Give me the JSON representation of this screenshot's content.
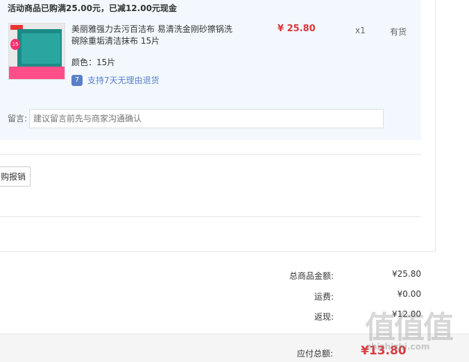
{
  "promo": {
    "text": "活动商品已购满25.00元，已减12.00元现金"
  },
  "item": {
    "title": "美丽雅强力去污百洁布 易清洗金刚砂擦锅洗碗除重垢清洁抹布 15片",
    "price": "¥ 25.80",
    "quantity": "x1",
    "stock": "有货",
    "color": "颜色：15片",
    "return_policy": "支持7天无理由退货"
  },
  "message": {
    "label": "留言:",
    "placeholder": "建议留言前先与商家沟通确认"
  },
  "actions": {
    "report_label": "购报销"
  },
  "summary": {
    "goods_total_label": "总商品金额:",
    "goods_total_value": "¥25.80",
    "shipping_label": "运费:",
    "shipping_value": "¥0.00",
    "cashback_label": "返现:",
    "cashback_value": "¥12.00"
  },
  "total": {
    "label": "应付总额:",
    "value": "¥13.80"
  },
  "watermark": {
    "text": "值值值",
    "domain": "zhizhizhi.com"
  },
  "colors": {
    "card_bg": "#f2f8fd",
    "price_red": "#d9383b",
    "link_blue": "#5b7fc7"
  }
}
